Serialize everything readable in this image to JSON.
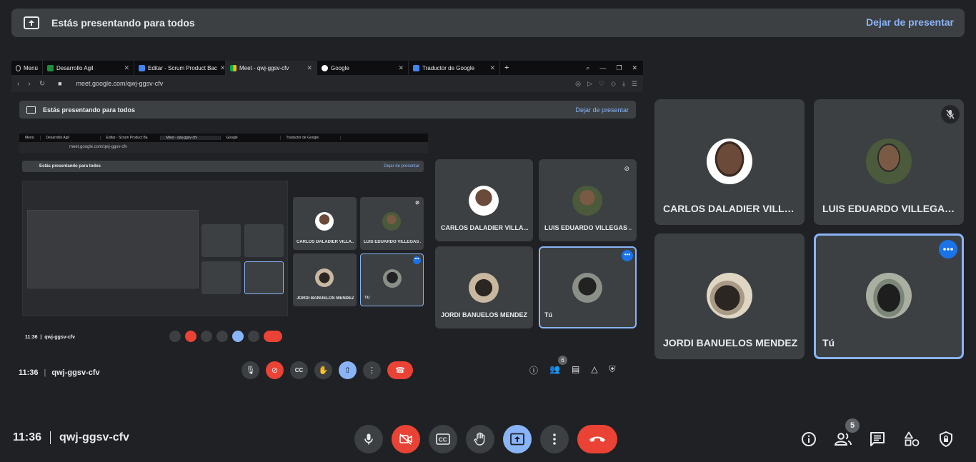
{
  "banner": {
    "text": "Estás presentando para todos",
    "stop_label": "Dejar de presentar"
  },
  "screen": {
    "tabs": [
      {
        "label": "Menú",
        "icon": "opera-icon"
      },
      {
        "label": "Desarrollo Agil",
        "icon": "classroom-icon"
      },
      {
        "label": "Editar - Scrum Product Bac",
        "icon": "editor-icon"
      },
      {
        "label": "Meet - qwj-ggsv-cfv",
        "icon": "meet-icon"
      },
      {
        "label": "Google",
        "icon": "google-icon"
      },
      {
        "label": "Traductor de Google",
        "icon": "translate-icon"
      }
    ],
    "url": "meet.google.com/qwj-ggsv-cfv",
    "inner_banner_text": "Estás presentando para todos",
    "inner_banner_stop": "Dejar de presentar",
    "nested_banner_text": "Estás presentando para todos",
    "nested_banner_stop": "Dejar de presentar",
    "nested_url": "meet.google.com/qwj-ggsv-cfv",
    "nested_tabs": [
      "Menú",
      "Desarrollo Agil",
      "Editar - Scrum Product Ba",
      "Meet - qwj-ggsv-cfv",
      "Google",
      "Traductor de Google"
    ],
    "tiles": [
      {
        "name": "CARLOS DALADIER VILLA..."
      },
      {
        "name": "LUIS EDUARDO VILLEGAS ..."
      },
      {
        "name": "JORDI BANUELOS MENDEZ"
      },
      {
        "name": "Tú"
      }
    ],
    "mini_tiles": [
      {
        "name": "CARLOS DALADIER VILLA..."
      },
      {
        "name": "LUIS EDUARDO VILLEGAS ..."
      },
      {
        "name": "JORDI BANUELOS MENDEZ"
      },
      {
        "name": "Tú"
      }
    ],
    "nested_time": "11:36",
    "nested_meeting": "qwj-ggsv-cfv",
    "footer_time": "11:36",
    "footer_meeting": "qwj-ggsv-cfv",
    "footer_badge": "5",
    "footer_nested_badge": "6",
    "footer_meeting_outer": "qwj-ggsv-cfv",
    "footer_time_outer": "11:36",
    "inner_footer_badge": "6"
  },
  "participants": [
    {
      "name": "CARLOS DALADIER VILLA...",
      "muted": false,
      "is_me": false
    },
    {
      "name": "LUIS EDUARDO VILLEGAS ...",
      "muted": true,
      "is_me": false
    },
    {
      "name": "JORDI BANUELOS MENDEZ",
      "muted": false,
      "is_me": false
    },
    {
      "name": "Tú",
      "muted": false,
      "is_me": true
    }
  ],
  "bottom": {
    "time": "11:36",
    "meeting_code": "qwj-ggsv-cfv",
    "people_count": "5"
  },
  "colors": {
    "background": "#202124",
    "tile": "#3c4043",
    "accent": "#8ab4f8",
    "danger": "#ea4335",
    "more_button": "#1a73e8"
  }
}
